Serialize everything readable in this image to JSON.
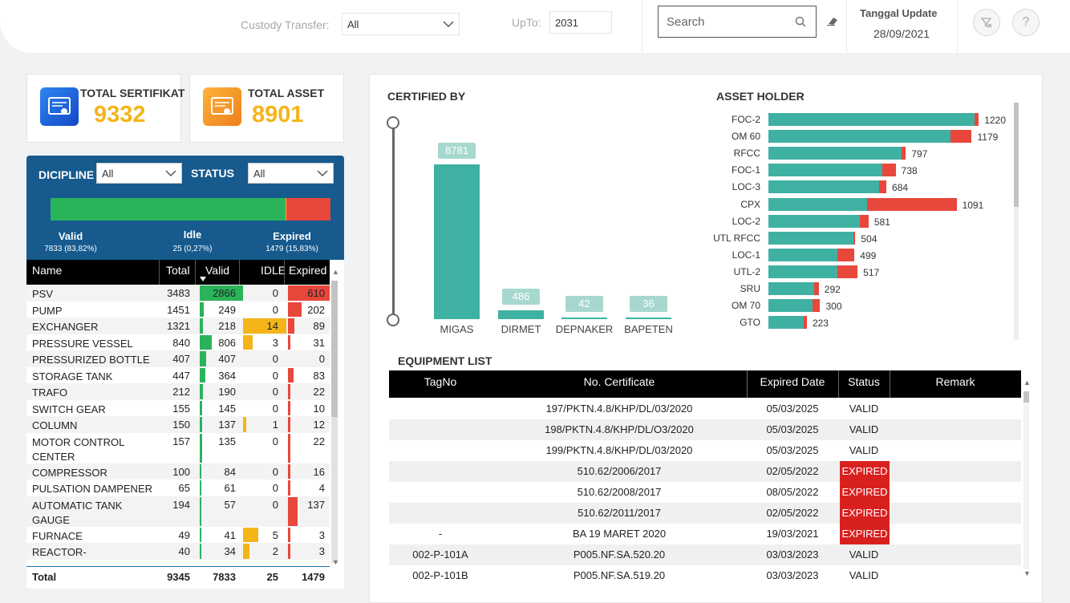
{
  "topbar": {
    "custody_label": "Custody Transfer:",
    "custody_value": "All",
    "upto_label": "UpTo:",
    "upto_value": "2031",
    "search_placeholder": "Search",
    "update_title": "Tanggal Update",
    "update_date": "28/09/2021"
  },
  "kpis": [
    {
      "title": "TOTAL SERTIFIKAT",
      "value": "9332",
      "icon": "certificate-icon",
      "color": "#1d6fe0"
    },
    {
      "title": "TOTAL ASSET",
      "value": "8901",
      "icon": "asset-icon",
      "color": "#f5a623"
    }
  ],
  "colors": {
    "accent": "#f5b418",
    "panel": "#165a8e",
    "valid": "#2bb35a",
    "expired": "#e8473b",
    "teal": "#3fb1a3"
  },
  "discipline": {
    "dicipline_label": "DICIPLINE",
    "dicipline_value": "All",
    "status_label": "STATUS",
    "status_value": "All",
    "summary": {
      "valid_label": "Valid",
      "valid_sub": "7833 (83,82%)",
      "valid_frac": 0.8382,
      "idle_label": "Idle",
      "idle_sub": "25 (0,27%)",
      "idle_frac": 0.0027,
      "expired_label": "Expired",
      "expired_sub": "1479 (15,83%)",
      "expired_frac": 0.1583
    },
    "headers": {
      "name": "Name",
      "total": "Total",
      "valid": "Valid",
      "idle": "IDLE",
      "expired": "Expired"
    },
    "rows": [
      {
        "name": "PSV",
        "total": "3483",
        "valid": "2866",
        "idle": "0",
        "expired": "610"
      },
      {
        "name": "PUMP",
        "total": "1451",
        "valid": "249",
        "idle": "0",
        "expired": "202"
      },
      {
        "name": "EXCHANGER",
        "total": "1321",
        "valid": "218",
        "idle": "14",
        "expired": "89"
      },
      {
        "name": "PRESSURE VESSEL",
        "total": "840",
        "valid": "806",
        "idle": "3",
        "expired": "31"
      },
      {
        "name": "PRESSURIZED BOTTLE",
        "total": "407",
        "valid": "407",
        "idle": "0",
        "expired": "0"
      },
      {
        "name": "STORAGE TANK",
        "total": "447",
        "valid": "364",
        "idle": "0",
        "expired": "83"
      },
      {
        "name": "TRAFO",
        "total": "212",
        "valid": "190",
        "idle": "0",
        "expired": "22"
      },
      {
        "name": "SWITCH GEAR",
        "total": "155",
        "valid": "145",
        "idle": "0",
        "expired": "10"
      },
      {
        "name": "COLUMN",
        "total": "150",
        "valid": "137",
        "idle": "1",
        "expired": "12"
      },
      {
        "name": "MOTOR CONTROL CENTER",
        "total": "157",
        "valid": "135",
        "idle": "0",
        "expired": "22"
      },
      {
        "name": "COMPRESSOR",
        "total": "100",
        "valid": "84",
        "idle": "0",
        "expired": "16"
      },
      {
        "name": "PULSATION DAMPENER",
        "total": "65",
        "valid": "61",
        "idle": "0",
        "expired": "4"
      },
      {
        "name": "AUTOMATIC TANK GAUGE",
        "total": "194",
        "valid": "57",
        "idle": "0",
        "expired": "137"
      },
      {
        "name": "FURNACE",
        "total": "49",
        "valid": "41",
        "idle": "5",
        "expired": "3"
      },
      {
        "name": "REACTOR-",
        "total": "40",
        "valid": "34",
        "idle": "2",
        "expired": "3"
      }
    ],
    "totals": {
      "label": "Total",
      "total": "9345",
      "valid": "7833",
      "idle": "25",
      "expired": "1479"
    }
  },
  "certified_by": {
    "title": "CERTIFIED BY",
    "chart_data": {
      "type": "bar",
      "categories": [
        "MIGAS",
        "DIRMET",
        "DEPNAKER",
        "BAPETEN"
      ],
      "values": [
        8781,
        486,
        42,
        36
      ]
    }
  },
  "asset_holder": {
    "title": "ASSET HOLDER",
    "chart_data": {
      "type": "bar",
      "orientation": "horizontal",
      "categories": [
        "FOC-2",
        "OM 60",
        "RFCC",
        "FOC-1",
        "LOC-3",
        "CPX",
        "LOC-2",
        "UTL RFCC",
        "LOC-1",
        "UTL-2",
        "SRU",
        "OM 70",
        "GTO"
      ],
      "totals": [
        1220,
        1179,
        797,
        738,
        684,
        1091,
        581,
        504,
        499,
        517,
        292,
        300,
        223
      ],
      "series": [
        {
          "values": [
            1195,
            1055,
            770,
            660,
            640,
            570,
            530,
            495,
            400,
            400,
            265,
            255,
            205
          ]
        },
        {
          "values": [
            0,
            0,
            0,
            0,
            0,
            0,
            0,
            0,
            0,
            0,
            0,
            0,
            0
          ]
        },
        {
          "values": [
            25,
            124,
            27,
            78,
            44,
            521,
            51,
            9,
            99,
            117,
            27,
            45,
            18
          ]
        }
      ]
    }
  },
  "equipment": {
    "title": "EQUIPMENT LIST",
    "headers": {
      "tag": "TagNo",
      "cert": "No. Certificate",
      "date": "Expired Date",
      "status": "Status",
      "remark": "Remark"
    },
    "rows": [
      {
        "tag": "",
        "cert": "197/PKTN.4.8/KHP/DL/03/2020",
        "date": "05/03/2025",
        "status": "VALID"
      },
      {
        "tag": "",
        "cert": "198/PKTN.4.8/KHP/DL/O3/2020",
        "date": "05/03/2025",
        "status": "VALID"
      },
      {
        "tag": "",
        "cert": "199/PKTN.4.8/KHP/DL/03/2020",
        "date": "05/03/2025",
        "status": "VALID"
      },
      {
        "tag": "",
        "cert": "510.62/2006/2017",
        "date": "02/05/2022",
        "status": "EXPIRED"
      },
      {
        "tag": "",
        "cert": "510.62/2008/2017",
        "date": "08/05/2022",
        "status": "EXPIRED"
      },
      {
        "tag": "",
        "cert": "510.62/2011/2017",
        "date": "02/05/2022",
        "status": "EXPIRED"
      },
      {
        "tag": "-",
        "cert": "BA 19 MARET 2020",
        "date": "19/03/2021",
        "status": "EXPIRED"
      },
      {
        "tag": "002-P-101A",
        "cert": "P005.NF.SA.520.20",
        "date": "03/03/2023",
        "status": "VALID"
      },
      {
        "tag": "002-P-101B",
        "cert": "P005.NF.SA.519.20",
        "date": "03/03/2023",
        "status": "VALID"
      }
    ]
  }
}
